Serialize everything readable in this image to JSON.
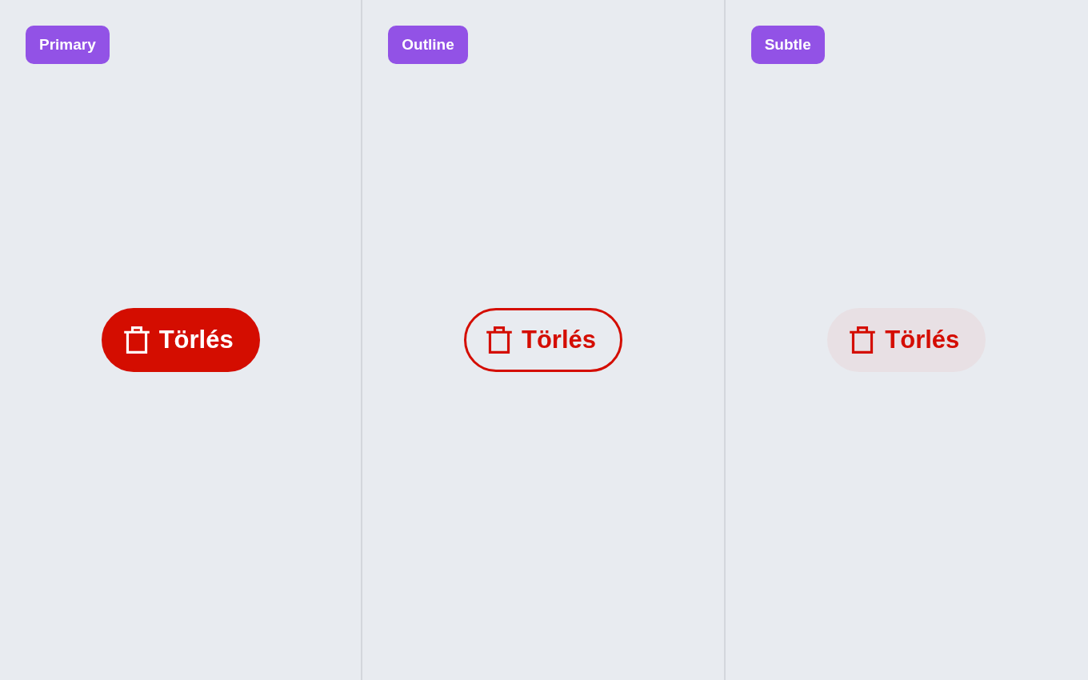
{
  "panels": [
    {
      "label": "Primary",
      "kind": "primary",
      "button": {
        "label": "Törlés"
      }
    },
    {
      "label": "Outline",
      "kind": "outline",
      "button": {
        "label": "Törlés"
      }
    },
    {
      "label": "Subtle",
      "kind": "subtle",
      "button": {
        "label": "Törlés"
      }
    }
  ]
}
